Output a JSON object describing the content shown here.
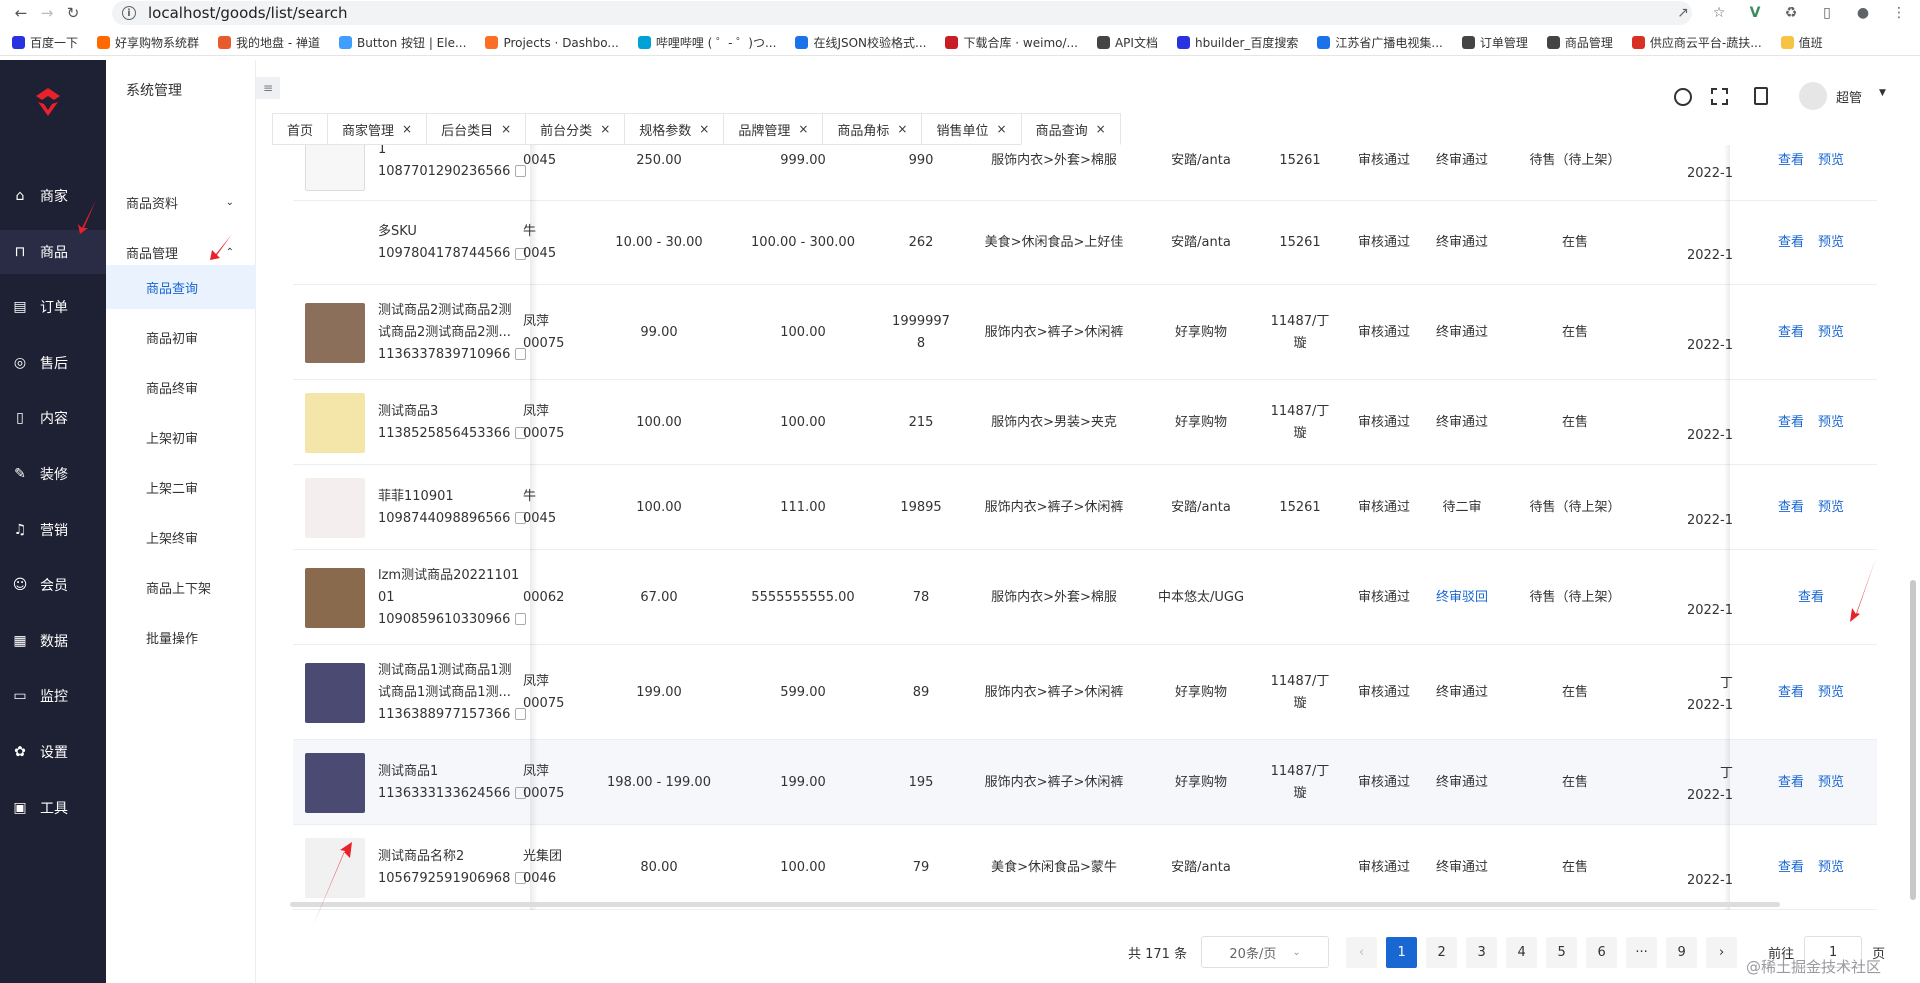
{
  "browser": {
    "url": "localhost/goods/list/search",
    "bookmarks": [
      {
        "label": "百度一下",
        "color": "#2932e1"
      },
      {
        "label": "好享购物系统群",
        "color": "#ff6a00"
      },
      {
        "label": "我的地盘 - 禅道",
        "color": "#e85a2c"
      },
      {
        "label": "Button 按钮 | Ele...",
        "color": "#409eff"
      },
      {
        "label": "Projects · Dashbo...",
        "color": "#fc6d26"
      },
      {
        "label": "哔哩哔哩 ( ゜- ゜)つ...",
        "color": "#00a1d6"
      },
      {
        "label": "在线JSON校验格式...",
        "color": "#1a73e8"
      },
      {
        "label": "下载合库 · weimo/...",
        "color": "#c71d23"
      },
      {
        "label": "API文档",
        "color": "#444"
      },
      {
        "label": "hbuilder_百度搜索",
        "color": "#2932e1"
      },
      {
        "label": "江苏省广播电视集...",
        "color": "#1a73e8"
      },
      {
        "label": "订单管理",
        "color": "#444"
      },
      {
        "label": "商品管理",
        "color": "#444"
      },
      {
        "label": "供应商云平台-蔬扶...",
        "color": "#d93025"
      },
      {
        "label": "值班",
        "color": "#f6c343"
      }
    ]
  },
  "sidebar": {
    "items": [
      {
        "label": "商家",
        "icon": "store-icon"
      },
      {
        "label": "商品",
        "icon": "bag-icon"
      },
      {
        "label": "订单",
        "icon": "order-icon"
      },
      {
        "label": "售后",
        "icon": "service-icon"
      },
      {
        "label": "内容",
        "icon": "book-icon"
      },
      {
        "label": "装修",
        "icon": "brush-icon"
      },
      {
        "label": "营销",
        "icon": "bell-icon"
      },
      {
        "label": "会员",
        "icon": "member-icon"
      },
      {
        "label": "数据",
        "icon": "calendar-icon"
      },
      {
        "label": "监控",
        "icon": "monitor-icon"
      },
      {
        "label": "设置",
        "icon": "gear-icon"
      },
      {
        "label": "工具",
        "icon": "toolbox-icon"
      }
    ]
  },
  "submenu": {
    "title": "系统管理",
    "groups": [
      {
        "label": "商品资料"
      },
      {
        "label": "商品管理"
      }
    ],
    "leaves": [
      "商品查询",
      "商品初审",
      "商品终审",
      "上架初审",
      "上架二审",
      "上架终审",
      "商品上下架",
      "批量操作"
    ]
  },
  "header": {
    "user": "超管"
  },
  "tabs": [
    "首页",
    "商家管理",
    "后台类目",
    "前台分类",
    "规格参数",
    "品牌管理",
    "商品角标",
    "销售单位",
    "商品查询"
  ],
  "table": {
    "rows": [
      {
        "name1": "1",
        "id": "1087701290236566",
        "shop1": "",
        "shop2": "0045",
        "cost": "250.00",
        "price": "999.00",
        "stock": "990",
        "category": "服饰内衣>外套>棉服",
        "brand": "安踏/anta",
        "unit": "15261",
        "audit": "审核通过",
        "final": "终审通过",
        "status": "待售（待上架）",
        "date": "2022-1",
        "ops": [
          "查看",
          "预览"
        ]
      },
      {
        "name1": "多SKU",
        "id": "1097804178744566",
        "shop1": "牛",
        "shop2": "0045",
        "cost": "10.00 - 30.00",
        "price": "100.00 - 300.00",
        "stock": "262",
        "category": "美食>休闲食品>上好佳",
        "brand": "安踏/anta",
        "unit": "15261",
        "audit": "审核通过",
        "final": "终审通过",
        "status": "在售",
        "date": "2022-1",
        "ops": [
          "查看",
          "预览"
        ]
      },
      {
        "name1": "测试商品2测试商品2测",
        "name2": "试商品2测试商品2测...",
        "id": "1136337839710966",
        "shop1": "凤萍",
        "shop2": "00075",
        "cost": "99.00",
        "price": "100.00",
        "stock": "1999997",
        "stock2": "8",
        "category": "服饰内衣>裤子>休闲裤",
        "brand": "好享购物",
        "unit": "11487/丁",
        "unit2": "璇",
        "audit": "审核通过",
        "final": "终审通过",
        "status": "在售",
        "date": "2022-1",
        "ops": [
          "查看",
          "预览"
        ]
      },
      {
        "name1": "测试商品3",
        "id": "1138525856453366",
        "shop1": "凤萍",
        "shop2": "00075",
        "cost": "100.00",
        "price": "100.00",
        "stock": "215",
        "category": "服饰内衣>男装>夹克",
        "brand": "好享购物",
        "unit": "11487/丁",
        "unit2": "璇",
        "audit": "审核通过",
        "final": "终审通过",
        "status": "在售",
        "date": "2022-1",
        "ops": [
          "查看",
          "预览"
        ]
      },
      {
        "name1": "菲菲110901",
        "id": "1098744098896566",
        "shop1": "牛",
        "shop2": "0045",
        "cost": "100.00",
        "price": "111.00",
        "stock": "19895",
        "category": "服饰内衣>裤子>休闲裤",
        "brand": "安踏/anta",
        "unit": "15261",
        "audit": "审核通过",
        "final": "待二审",
        "status": "待售（待上架）",
        "date": "2022-1",
        "ops": [
          "查看",
          "预览"
        ]
      },
      {
        "name1": "lzm测试商品20221101",
        "name2": "01",
        "id": "1090859610330966",
        "shop1": "",
        "shop2": "00062",
        "cost": "67.00",
        "price": "5555555555.00",
        "stock": "78",
        "category": "服饰内衣>外套>棉服",
        "brand": "中本悠太/UGG",
        "unit": "",
        "audit": "审核通过",
        "final": "终审驳回",
        "status": "待售（待上架）",
        "date": "2022-1",
        "ops": [
          "查看"
        ]
      },
      {
        "name1": "测试商品1测试商品1测",
        "name2": "试商品1测试商品1测...",
        "id": "1136388977157366",
        "shop1": "凤萍",
        "shop2": "00075",
        "cost": "199.00",
        "price": "599.00",
        "stock": "89",
        "category": "服饰内衣>裤子>休闲裤",
        "brand": "好享购物",
        "unit": "11487/丁",
        "unit2": "璇",
        "audit": "审核通过",
        "final": "终审通过",
        "status": "在售",
        "date": "2022-1",
        "extra": "丁",
        "ops": [
          "查看",
          "预览"
        ]
      },
      {
        "name1": "测试商品1",
        "id": "1136333133624566",
        "shop1": "凤萍",
        "shop2": "00075",
        "cost": "198.00 - 199.00",
        "price": "199.00",
        "stock": "195",
        "category": "服饰内衣>裤子>休闲裤",
        "brand": "好享购物",
        "unit": "11487/丁",
        "unit2": "璇",
        "audit": "审核通过",
        "final": "终审通过",
        "status": "在售",
        "date": "2022-1",
        "extra": "丁",
        "ops": [
          "查看",
          "预览"
        ]
      },
      {
        "name1": "测试商品名称2",
        "id": "1056792591906968",
        "shop1": "光集团",
        "shop2": "0046",
        "cost": "80.00",
        "price": "100.00",
        "stock": "79",
        "category": "美食>休闲食品>蒙牛",
        "brand": "安踏/anta",
        "unit": "",
        "audit": "审核通过",
        "final": "终审通过",
        "status": "在售",
        "date": "2022-1",
        "ops": [
          "查看",
          "预览"
        ]
      }
    ]
  },
  "pagination": {
    "total": "共 171 条",
    "page_size": "20条/页",
    "prev": "‹",
    "pages": [
      "1",
      "2",
      "3",
      "4",
      "5",
      "6",
      "···",
      "9"
    ],
    "next": "›",
    "goto_label": "前往",
    "goto_value": "1",
    "page_suffix": "页"
  },
  "watermark": "@稀土掘金技术社区",
  "colors": {
    "sidebar": "#1e2033",
    "primary": "#1967d2",
    "arrow": "#e8212b"
  }
}
